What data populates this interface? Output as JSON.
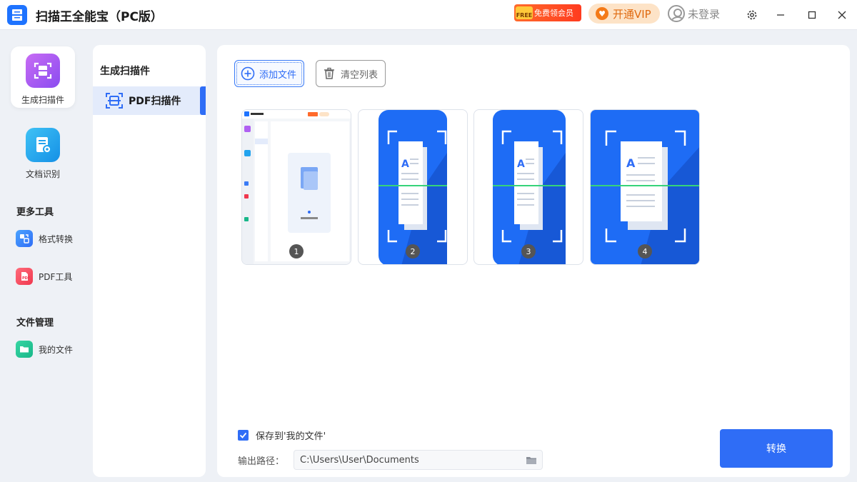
{
  "app": {
    "title": "扫描王全能宝（PC版）"
  },
  "header": {
    "promo_tag": "FREE",
    "promo_label": "免费领会员",
    "vip_label": "开通VIP",
    "login_label": "未登录"
  },
  "sidebar": {
    "primary": [
      {
        "label": "生成扫描件",
        "icon": "scan-icon",
        "active": true
      },
      {
        "label": "文档识别",
        "icon": "document-ocr-icon",
        "active": false
      }
    ],
    "more_tools_title": "更多工具",
    "more_tools": [
      {
        "label": "格式转换",
        "icon": "format-convert-icon"
      },
      {
        "label": "PDF工具",
        "icon": "pdf-tool-icon"
      }
    ],
    "file_mgmt_title": "文件管理",
    "file_mgmt": [
      {
        "label": "我的文件",
        "icon": "folder-icon"
      }
    ]
  },
  "subpanel": {
    "title": "生成扫描件",
    "items": [
      {
        "label": "PDF扫描件",
        "icon": "pdf-scan-icon",
        "active": true
      }
    ]
  },
  "toolbar": {
    "add_label": "添加文件",
    "clear_label": "清空列表"
  },
  "thumbnails": [
    {
      "number": "1",
      "kind": "app-screenshot"
    },
    {
      "number": "2",
      "kind": "scan-graphic"
    },
    {
      "number": "3",
      "kind": "scan-graphic"
    },
    {
      "number": "4",
      "kind": "scan-graphic"
    }
  ],
  "footer": {
    "save_label": "保存到'我的文件'",
    "save_checked": true,
    "path_label": "输出路径：",
    "path_value": "C:\\Users\\User\\Documents",
    "convert_label": "转换"
  },
  "colors": {
    "accent": "#2f6df6",
    "vip": "#f47a18",
    "background": "#eef1f6"
  }
}
